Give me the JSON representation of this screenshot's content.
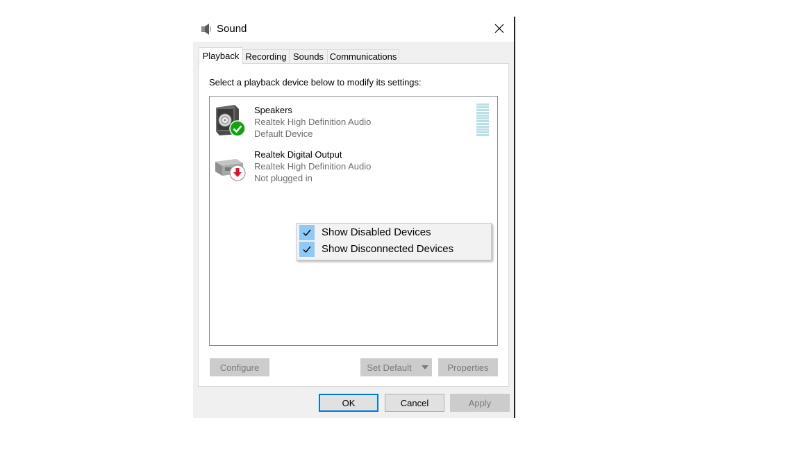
{
  "window": {
    "title": "Sound"
  },
  "tabs": [
    {
      "label": "Playback",
      "active": true
    },
    {
      "label": "Recording",
      "active": false
    },
    {
      "label": "Sounds",
      "active": false
    },
    {
      "label": "Communications",
      "active": false
    }
  ],
  "playback": {
    "instruction": "Select a playback device below to modify its settings:",
    "devices": [
      {
        "name": "Speakers",
        "driver": "Realtek High Definition Audio",
        "status": "Default Device",
        "icon": "speaker-icon",
        "badge": "green-check-badge"
      },
      {
        "name": "Realtek Digital Output",
        "driver": "Realtek High Definition Audio",
        "status": "Not plugged in",
        "icon": "digital-output-icon",
        "badge": "red-down-arrow-badge"
      }
    ],
    "level_meter": {
      "segments": 12
    },
    "buttons": {
      "configure": "Configure",
      "set_default": "Set Default",
      "properties": "Properties"
    }
  },
  "context_menu": {
    "items": [
      {
        "label": "Show Disabled Devices",
        "checked": true
      },
      {
        "label": "Show Disconnected Devices",
        "checked": true
      }
    ]
  },
  "dialog_buttons": {
    "ok": "OK",
    "cancel": "Cancel",
    "apply": "Apply"
  },
  "colors": {
    "accent_border": "#0078d7",
    "checkmark_highlight": "#90c8f6",
    "default_badge": "#13a10e",
    "unplugged_badge": "#e81123"
  }
}
